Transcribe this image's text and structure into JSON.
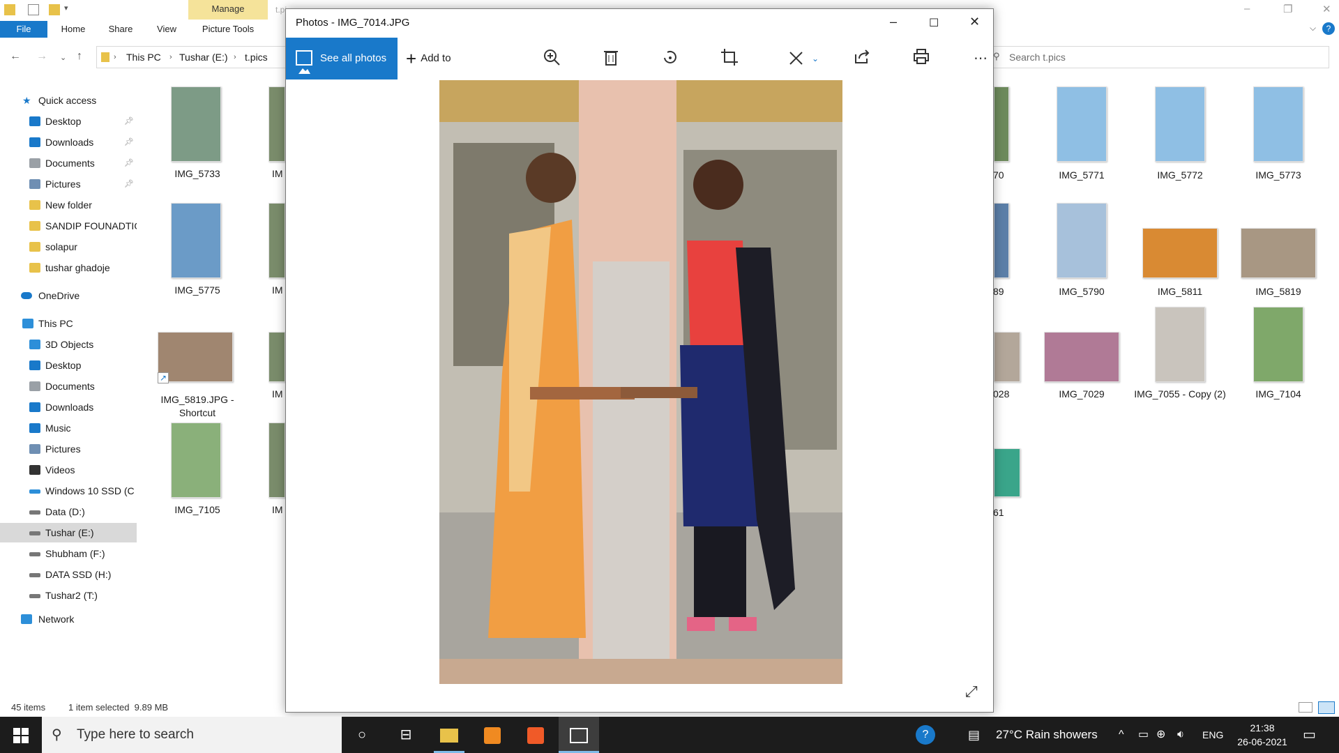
{
  "ribbon": {
    "manage": "Manage",
    "picture_tools": "Picture Tools",
    "tabs": [
      "File",
      "Home",
      "Share",
      "View"
    ],
    "faded_title": "t.pi"
  },
  "address": {
    "crumbs": [
      "This PC",
      "Tushar (E:)",
      "t.pics"
    ],
    "search_placeholder": "Search t.pics"
  },
  "nav": {
    "quick_access": "Quick access",
    "qa_items": [
      "Desktop",
      "Downloads",
      "Documents",
      "Pictures",
      "New folder",
      "SANDIP FOUNADTIO",
      "solapur",
      "tushar ghadoje"
    ],
    "onedrive": "OneDrive",
    "this_pc": "This PC",
    "pc_items": [
      "3D Objects",
      "Desktop",
      "Documents",
      "Downloads",
      "Music",
      "Pictures",
      "Videos",
      "Windows 10 SSD (C",
      "Data (D:)",
      "Tushar (E:)",
      "Shubham (F:)",
      "DATA SSD (H:)",
      "Tushar2 (T:)"
    ],
    "network": "Network"
  },
  "files": {
    "left_col": [
      "IMG_5733",
      "IMG_5775",
      "IMG_5819.JPG - Shortcut",
      "IMG_7105"
    ],
    "left_col2_partial": [
      "IM",
      "IM",
      "IM",
      "IM"
    ],
    "right_partial": [
      "70",
      "89",
      "028",
      "61"
    ],
    "right": [
      [
        "IMG_5771",
        "IMG_5772",
        "IMG_5773"
      ],
      [
        "IMG_5790",
        "IMG_5811",
        "IMG_5819"
      ],
      [
        "IMG_7029",
        "IMG_7055 - Copy (2)",
        "IMG_7104"
      ]
    ]
  },
  "status": {
    "items": "45 items",
    "selected": "1 item selected  9.89 MB"
  },
  "photos": {
    "title": "Photos - IMG_7014.JPG",
    "see_all": "See all photos",
    "add_to": "Add to"
  },
  "taskbar": {
    "search_placeholder": "Type here to search",
    "weather": "27°C  Rain showers",
    "lang": "ENG",
    "time": "21:38",
    "date": "26-06-2021"
  },
  "colors": {
    "accent": "#1979ca",
    "manage_tab": "#f5e39a",
    "taskbar": "#1c1c1c"
  }
}
